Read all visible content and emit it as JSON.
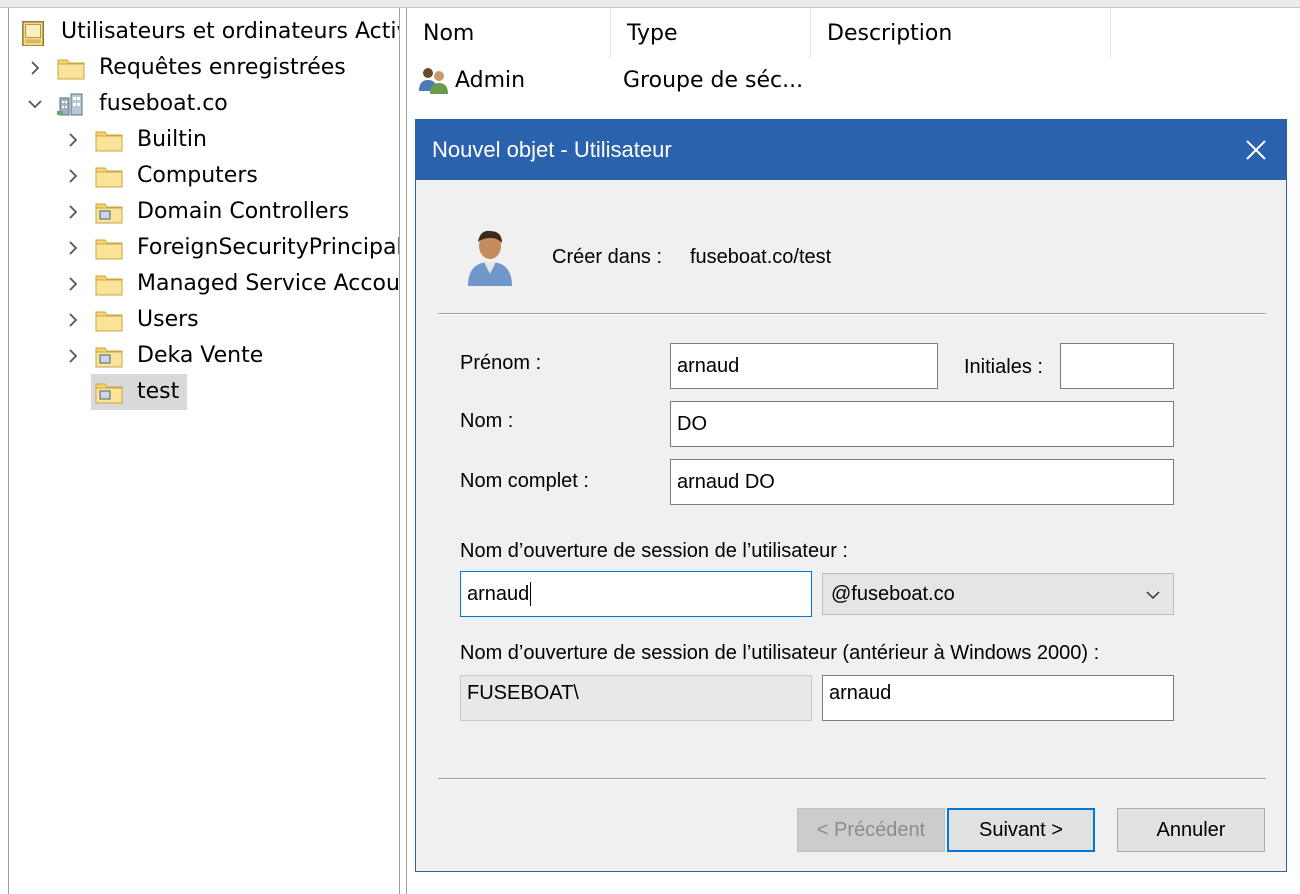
{
  "tree": {
    "root": "Utilisateurs et ordinateurs Active",
    "items": [
      {
        "label": "Requêtes enregistrées"
      },
      {
        "label": "fuseboat.co"
      },
      {
        "label": "Builtin"
      },
      {
        "label": "Computers"
      },
      {
        "label": "Domain Controllers"
      },
      {
        "label": "ForeignSecurityPrincipals"
      },
      {
        "label": "Managed Service Accoun"
      },
      {
        "label": "Users"
      },
      {
        "label": "Deka Vente"
      },
      {
        "label": "test"
      }
    ]
  },
  "list": {
    "columns": [
      "Nom",
      "Type",
      "Description"
    ],
    "rows": [
      {
        "name": "Admin",
        "type": "Groupe de séc..."
      }
    ]
  },
  "dialog": {
    "title": "Nouvel objet - Utilisateur",
    "create_in_label": "Créer dans :",
    "create_in_value": "fuseboat.co/test",
    "first_name_label": "Prénom :",
    "first_name_value": "arnaud",
    "initials_label": "Initiales :",
    "initials_value": "",
    "last_name_label": "Nom :",
    "last_name_value": "DO",
    "full_name_label": "Nom complet :",
    "full_name_value": "arnaud DO",
    "logon_label": "Nom d’ouverture de session de l’utilisateur :",
    "logon_value": "arnaud",
    "domain_value": "@fuseboat.co",
    "logon_pre2000_label": "Nom d’ouverture de session de l’utilisateur (antérieur à Windows 2000) :",
    "netbios_prefix": "FUSEBOAT\\",
    "logon_pre2000_value": "arnaud",
    "buttons": {
      "back": "< Précédent",
      "next": "Suivant >",
      "cancel": "Annuler"
    }
  },
  "colors": {
    "title_bar": "#2a62ad",
    "dialog_bg": "#f0f0f0",
    "focus_border": "#0078d7",
    "selection": "#d9d9d9"
  }
}
